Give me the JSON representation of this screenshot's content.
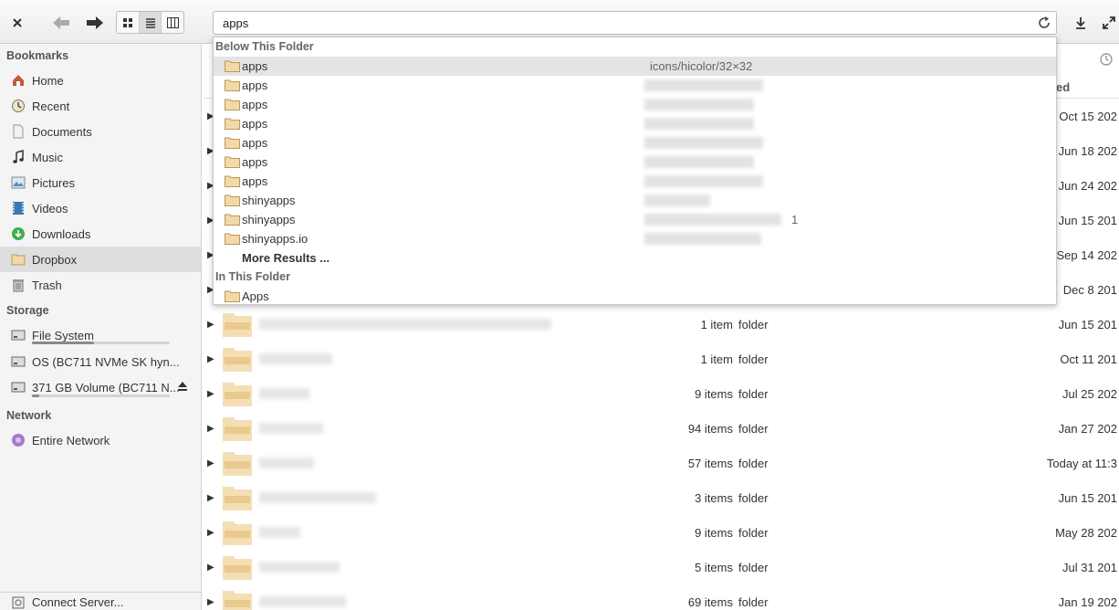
{
  "toolbar": {
    "search_value": "apps",
    "view_icons": [
      "icon-view-icon",
      "list-view-icon",
      "column-view-icon"
    ]
  },
  "sidebar": {
    "bookmarks_title": "Bookmarks",
    "bookmarks": [
      {
        "label": "Home",
        "icon": "home-icon"
      },
      {
        "label": "Recent",
        "icon": "recent-icon"
      },
      {
        "label": "Documents",
        "icon": "documents-icon"
      },
      {
        "label": "Music",
        "icon": "music-icon"
      },
      {
        "label": "Pictures",
        "icon": "pictures-icon"
      },
      {
        "label": "Videos",
        "icon": "videos-icon"
      },
      {
        "label": "Downloads",
        "icon": "downloads-icon"
      },
      {
        "label": "Dropbox",
        "icon": "folder-icon",
        "selected": true
      },
      {
        "label": "Trash",
        "icon": "trash-icon"
      }
    ],
    "storage_title": "Storage",
    "storage": [
      {
        "label": "File System",
        "usage": 0.45
      },
      {
        "label": "OS (BC711 NVMe SK hyn...",
        "usage": null
      },
      {
        "label": "371 GB Volume (BC711 N...",
        "usage": 0.05
      }
    ],
    "network_title": "Network",
    "network": [
      {
        "label": "Entire Network"
      }
    ],
    "connect_server": "Connect Server..."
  },
  "main": {
    "column_header_partial": "ed",
    "rows": [
      {
        "size": "",
        "kind": "",
        "date": "Oct 15 202"
      },
      {
        "size": "",
        "kind": "",
        "date": "Jun 18 202"
      },
      {
        "size": "",
        "kind": "",
        "date": "Jun 24 202"
      },
      {
        "size": "",
        "kind": "",
        "date": "Jun 15 201"
      },
      {
        "size": "",
        "kind": "",
        "date": "Sep 14 202"
      },
      {
        "size": "",
        "kind": "",
        "date": "Dec  8 201"
      },
      {
        "size": "1 item",
        "kind": "folder",
        "date": "Jun 15 201"
      },
      {
        "size": "1 item",
        "kind": "folder",
        "date": "Oct 11 201"
      },
      {
        "size": "9 items",
        "kind": "folder",
        "date": "Jul 25 202"
      },
      {
        "size": "94 items",
        "kind": "folder",
        "date": "Jan 27 202"
      },
      {
        "size": "57 items",
        "kind": "folder",
        "date": "Today at 11:3"
      },
      {
        "size": "3 items",
        "kind": "folder",
        "date": "Jun 15 201"
      },
      {
        "size": "9 items",
        "kind": "folder",
        "date": "May 28 202"
      },
      {
        "size": "5 items",
        "kind": "folder",
        "date": "Jul 31 201"
      },
      {
        "size": "69 items",
        "kind": "folder",
        "date": "Jan 19 202"
      }
    ]
  },
  "popup": {
    "below_title": "Below This Folder",
    "results": [
      {
        "name": "apps",
        "path": "icons/hicolor/32×32"
      },
      {
        "name": "apps",
        "path": ""
      },
      {
        "name": "apps",
        "path": ""
      },
      {
        "name": "apps",
        "path": ""
      },
      {
        "name": "apps",
        "path": ""
      },
      {
        "name": "apps",
        "path": ""
      },
      {
        "name": "apps",
        "path": ""
      },
      {
        "name": "shinyapps",
        "path": ""
      },
      {
        "name": "shinyapps",
        "path": "1"
      },
      {
        "name": "shinyapps.io",
        "path": ""
      }
    ],
    "more_results": "More Results ...",
    "in_title": "In This Folder",
    "in_results": [
      {
        "name": "Apps"
      }
    ]
  },
  "colors": {
    "folder": "#e9c98e",
    "selected_bg": "#dedede"
  }
}
